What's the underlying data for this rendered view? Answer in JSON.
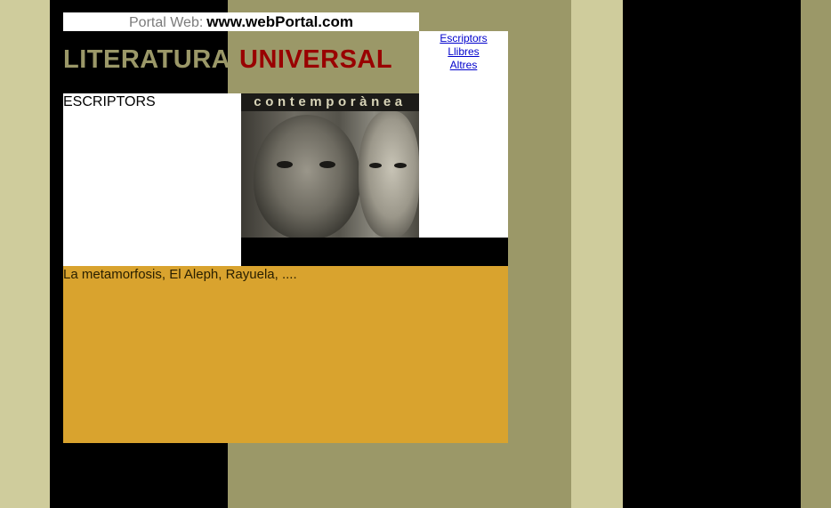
{
  "header": {
    "portal_label": "Portal Web:",
    "portal_url": "www.webPortal.com",
    "title_part1": "LITERATURA",
    "title_part2": "UNIVERSAL"
  },
  "nav": {
    "links": [
      "Escriptors",
      "Llibres",
      "Altres"
    ]
  },
  "sections": {
    "writers_heading": "ESCRIPTORS",
    "photo_caption": "contemporànea",
    "books_text": "La metamorfosis, El Aleph, Rayuela, ...."
  },
  "colors": {
    "olive": "#9b9868",
    "light_olive": "#cfcc9c",
    "dark_red": "#990000",
    "gold": "#d9a32e",
    "link_blue": "#0000cc"
  }
}
